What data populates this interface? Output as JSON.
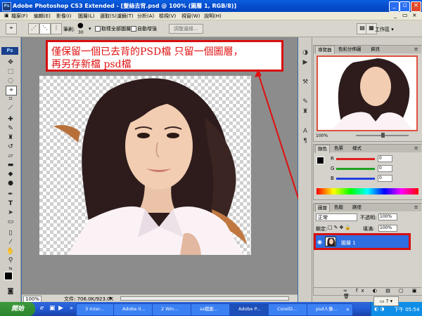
{
  "title": "Adobe Photoshop CS3 Extended - [髮絲去背.psd @ 100% (圖層 1, RGB/8)]",
  "menu": [
    "檔案(F)",
    "編輯(E)",
    "影像(I)",
    "圖層(L)",
    "選取(S)",
    "濾鏡(T)",
    "分析(A)",
    "檢視(V)",
    "視窗(W)",
    "說明(H)"
  ],
  "options": {
    "brush_label": "筆刷:",
    "brush_size": "30",
    "sample_all_label": "取樣全部圖層",
    "auto_enhance_label": "自動增強",
    "refine_edge_label": "調整邊緣...",
    "workspace_label": "工作區"
  },
  "annotation": {
    "line1": "僅保留一個已去背的PSD檔 只留一個圖層，",
    "line2": "再另存新檔 psd檔"
  },
  "navigator": {
    "tabs": [
      "導覽器",
      "色彩分佈圖",
      "資訊"
    ],
    "zoom": "100%"
  },
  "color": {
    "tabs": [
      "顏色",
      "色票",
      "樣式"
    ],
    "channels": [
      {
        "label": "R",
        "value": "0",
        "color": "#e02020"
      },
      {
        "label": "G",
        "value": "0",
        "color": "#20a020"
      },
      {
        "label": "B",
        "value": "0",
        "color": "#2040e0"
      }
    ]
  },
  "layers": {
    "tabs": [
      "圖層",
      "色版",
      "路徑"
    ],
    "blend_mode": "正常",
    "opacity_label": "不透明:",
    "opacity": "100%",
    "lock_label": "鎖定:",
    "fill_label": "填滿:",
    "fill": "100%",
    "layer_name": "圖層 1"
  },
  "status": {
    "zoom": "100%",
    "doc_info": "文件: 706.0K/923.0K"
  },
  "taskbar": {
    "start": "開始",
    "buttons": [
      "3 Inter...",
      "Adobe Il...",
      "2 Win...",
      "ss檔案...",
      "Adobe P...",
      "CorelD...",
      "psd人像..."
    ],
    "clock": "下午 05:54"
  }
}
